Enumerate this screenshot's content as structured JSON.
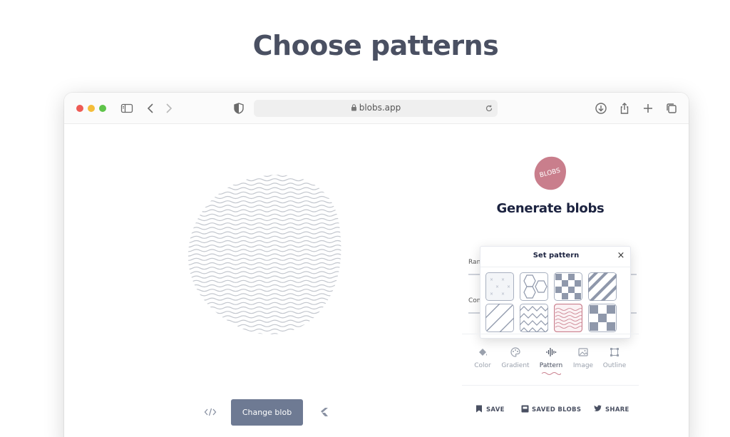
{
  "headline": "Choose patterns",
  "browser": {
    "url": "blobs.app"
  },
  "editor": {
    "change_blob_label": "Change blob"
  },
  "panel": {
    "logo_text": "BLOBS",
    "title": "Generate blobs",
    "slider_1_label": "Ran",
    "slider_2_label": "Con",
    "pattern_popup": {
      "title": "Set pattern",
      "close": "×",
      "patterns": [
        "dots",
        "hexagons",
        "checkers",
        "diagonal-stripes",
        "thin-diagonals",
        "zigzag",
        "waves",
        "large-checkers"
      ],
      "selected": "waves"
    },
    "tabs": [
      {
        "label": "Color",
        "icon": "paint-bucket-icon"
      },
      {
        "label": "Gradient",
        "icon": "palette-icon"
      },
      {
        "label": "Pattern",
        "icon": "sound-wave-icon"
      },
      {
        "label": "Image",
        "icon": "image-icon"
      },
      {
        "label": "Outline",
        "icon": "outline-icon"
      }
    ],
    "active_tab": "Pattern",
    "actions": {
      "save": "SAVE",
      "saved_blobs": "SAVED BLOBS",
      "share": "SHARE"
    }
  },
  "colors": {
    "accent_pink": "#c97e8c",
    "button": "#6e7a93",
    "title": "#1c2340"
  }
}
